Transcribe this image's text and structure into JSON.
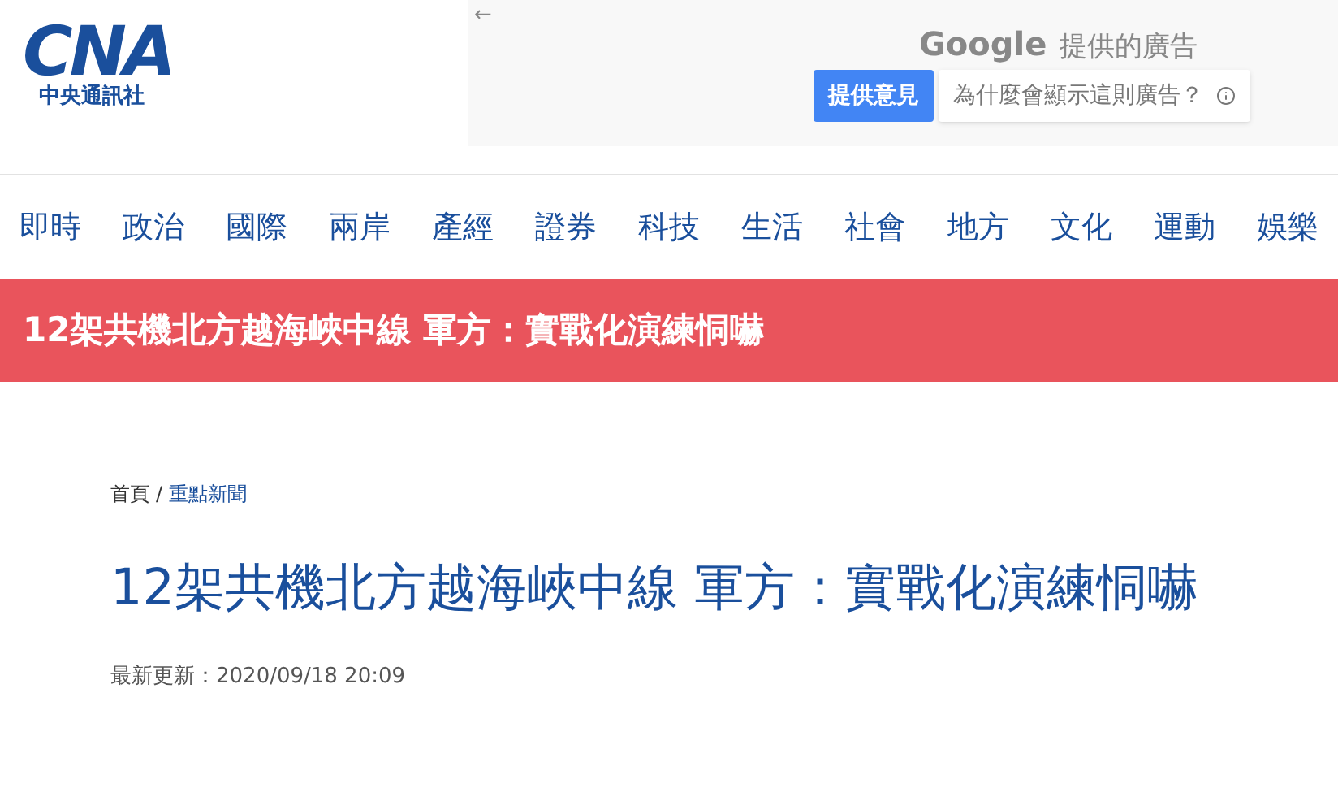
{
  "logo": {
    "letters": "CNA",
    "name": "中央通訊社"
  },
  "ad": {
    "back": "←",
    "brand": "Google",
    "provided": "提供的廣告",
    "feedback": "提供意見",
    "why": "為什麼會顯示這則廣告？"
  },
  "nav": [
    "即時",
    "政治",
    "國際",
    "兩岸",
    "產經",
    "證券",
    "科技",
    "生活",
    "社會",
    "地方",
    "文化",
    "運動",
    "娛樂"
  ],
  "banner": "12架共機北方越海峽中線 軍方：實戰化演練恫嚇",
  "breadcrumb": [
    "首頁",
    "重點新聞"
  ],
  "breadcrumb_separator": "/",
  "title": "12架共機北方越海峽中線 軍方：實戰化演練恫嚇",
  "updated": "最新更新：2020/09/18 20:09"
}
